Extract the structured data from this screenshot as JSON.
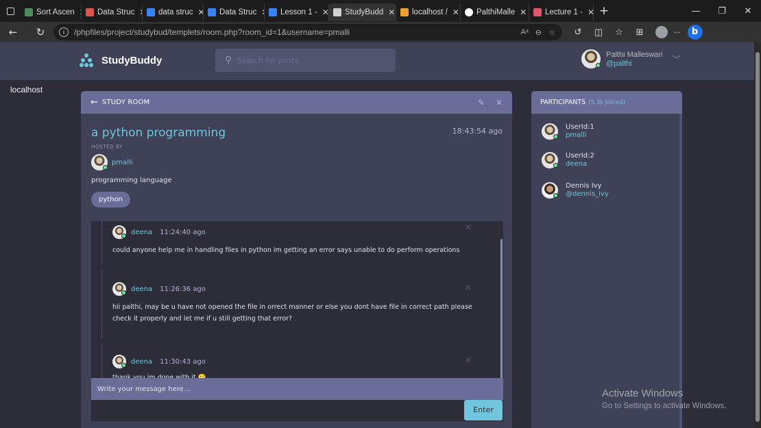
{
  "browser": {
    "tabs": [
      {
        "label": "Sort Ascen",
        "color": "#4a8c5c"
      },
      {
        "label": "Data Struc",
        "color": "#d9534f"
      },
      {
        "label": "data struc",
        "color": "#3b82f6"
      },
      {
        "label": "Data Struc",
        "color": "#3b82f6"
      },
      {
        "label": "Lesson 1 -",
        "color": "#3b82f6"
      },
      {
        "label": "StudyBudd",
        "color": "#cfcfcf",
        "active": true
      },
      {
        "label": "localhost /",
        "color": "#f0a030"
      },
      {
        "label": "PalthiMalle",
        "color": "#ffffff"
      },
      {
        "label": "Lecture 1 -",
        "color": "#e0566a"
      }
    ],
    "url_host": "localhost",
    "url_path": "/phpfiles/project/studybud/templets/room.php?room_id=1&username=pmalli"
  },
  "header": {
    "logo_text": "StudyBuddy",
    "search_placeholder": "Search for posts",
    "user_name": "Palthi Malleswari",
    "user_handle": "@palthi"
  },
  "room": {
    "header_label": "STUDY ROOM",
    "name": "a python programming",
    "time": "18:43:54 ago",
    "hosted_by_label": "HOSTED BY",
    "host": "pmalli",
    "description": "programming language",
    "topic": "python",
    "messages": [
      {
        "author": "deena",
        "time": "11:24:40 ago",
        "body": "could anyone help me in handling files in python im getting an error says unable to do perform operations"
      },
      {
        "author": "deena",
        "time": "11:26:36 ago",
        "body": "hii palthi, may be u have not opened the file in orrect manner or else you dont have file in correct path please check it properly and let me if u still getting that error?"
      },
      {
        "author": "deena",
        "time": "11:30:43 ago",
        "body": "thank you im done with it 🙂"
      }
    ],
    "compose_placeholder": "Write your message here...",
    "enter_label": "Enter"
  },
  "participants": {
    "title": "PARTICIPANTS",
    "count": "(5.3k Joined)",
    "items": [
      {
        "name": "UserId:1",
        "handle": "pmalli"
      },
      {
        "name": "UserId:2",
        "handle": "deena"
      },
      {
        "name": "Dennis Ivy",
        "handle": "@dennis_ivy"
      }
    ]
  },
  "watermark": {
    "line1": "Activate Windows",
    "line2": "Go to Settings to activate Windows."
  },
  "colors": {
    "bg": "#2d2d39",
    "panel": "#3f4156",
    "accent": "#71c6dd",
    "header": "#696d97"
  }
}
